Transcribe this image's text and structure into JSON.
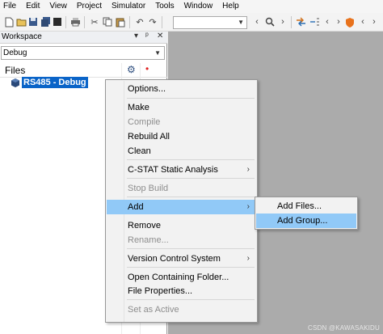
{
  "menubar": {
    "items": [
      "File",
      "Edit",
      "View",
      "Project",
      "Simulator",
      "Tools",
      "Window",
      "Help"
    ]
  },
  "toolbar": {
    "combo_value": ""
  },
  "workspace": {
    "title": "Workspace",
    "pin_glyph": "▾ ⊥ ✕",
    "configuration": "Debug",
    "files_header": "Files",
    "project_label": "RS485 - Debug"
  },
  "context_menu": {
    "items": [
      {
        "label": "Options...",
        "enabled": true
      },
      {
        "label": "Make",
        "enabled": true
      },
      {
        "label": "Compile",
        "enabled": false
      },
      {
        "label": "Rebuild All",
        "enabled": true
      },
      {
        "label": "Clean",
        "enabled": true
      },
      {
        "label": "C-STAT Static Analysis",
        "enabled": true,
        "submenu": true
      },
      {
        "label": "Stop Build",
        "enabled": false
      },
      {
        "label": "Add",
        "enabled": true,
        "submenu": true,
        "highlighted": true
      },
      {
        "label": "Remove",
        "enabled": true
      },
      {
        "label": "Rename...",
        "enabled": false
      },
      {
        "label": "Version Control System",
        "enabled": true,
        "submenu": true
      },
      {
        "label": "Open Containing Folder...",
        "enabled": true
      },
      {
        "label": "File Properties...",
        "enabled": true
      },
      {
        "label": "Set as Active",
        "enabled": false
      }
    ]
  },
  "submenu": {
    "items": [
      {
        "label": "Add Files...",
        "highlighted": false
      },
      {
        "label": "Add Group...",
        "highlighted": true
      }
    ]
  },
  "watermark": "CSDN @KAWASAKIDU",
  "colors": {
    "selection": "#0a64c8",
    "menu_highlight": "#91c9f7",
    "editor_background": "#ababab"
  }
}
